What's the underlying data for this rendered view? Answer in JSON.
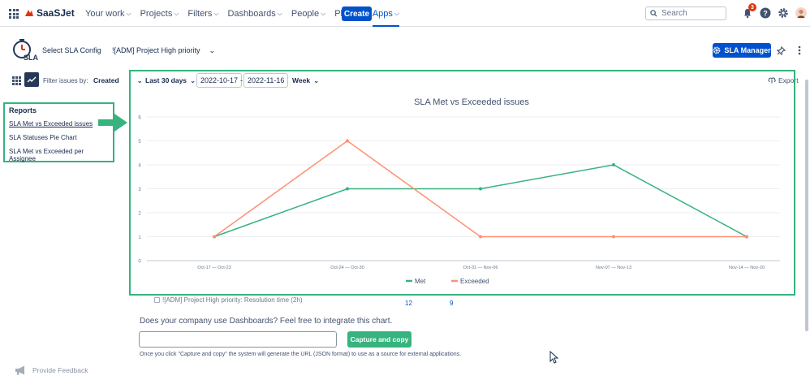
{
  "topbar": {
    "brand": "SaaSJet",
    "nav": [
      {
        "label": "Your work",
        "active": false
      },
      {
        "label": "Projects",
        "active": false
      },
      {
        "label": "Filters",
        "active": false
      },
      {
        "label": "Dashboards",
        "active": false
      },
      {
        "label": "People",
        "active": false
      },
      {
        "label": "Plans",
        "active": false
      },
      {
        "label": "Apps",
        "active": true
      }
    ],
    "create_label": "Create",
    "search_placeholder": "Search",
    "notification_count": "3"
  },
  "header": {
    "logo_text": "SLA",
    "select_label": "Select SLA Config",
    "selected_config": "![ADM] Project High priority",
    "sla_manager_label": "SLA Manager"
  },
  "filters": {
    "label": "Filter issues by:",
    "field": "Created",
    "range": "Last 30 days",
    "date_from": "2022-10-17",
    "date_separator": "-",
    "date_to": "2022-11-16",
    "granularity": "Week",
    "export_label": "Export"
  },
  "reports": {
    "title": "Reports",
    "items": [
      {
        "label": "SLA Met vs Exceeded issues",
        "current": true
      },
      {
        "label": "SLA Statuses Pie Chart",
        "current": false
      },
      {
        "label": "SLA Met vs Exceeded per Assignee",
        "current": false
      }
    ]
  },
  "chart_data": {
    "type": "line",
    "title": "SLA Met vs Exceeded issues",
    "categories": [
      "Oct-17 — Oct-23",
      "Oct-24 — Oct-30",
      "Oct-31 — Nov-06",
      "Nov-07 — Nov-13",
      "Nov-14 — Nov-20"
    ],
    "series": [
      {
        "name": "Met",
        "values": [
          1,
          3,
          3,
          4,
          1
        ],
        "color": "#36b37e"
      },
      {
        "name": "Exceeded",
        "values": [
          1,
          5,
          1,
          1,
          1
        ],
        "color": "#ff8f73"
      }
    ],
    "y_ticks": [
      "0",
      "1",
      "2",
      "3",
      "4",
      "5",
      "6"
    ],
    "ylim": [
      0,
      6
    ],
    "grid": true,
    "legend": "bottom-center"
  },
  "below": {
    "row_label": "![ADM] Project High priority: Resolution time (2h)",
    "met_count": "12",
    "exceeded_count": "9",
    "dashboard_question": "Does your company use Dashboards? Feel free to integrate this chart.",
    "capture_label": "Capture and copy",
    "help_text": "Once you click \"Capture and copy\" the system will generate the URL (JSON format) to use as a source for external applications.",
    "feedback_label": "Provide Feedback"
  }
}
